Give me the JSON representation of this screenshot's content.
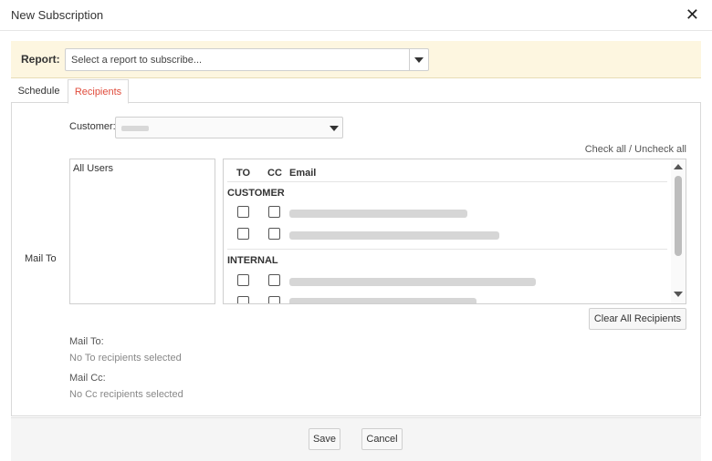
{
  "dialog": {
    "title": "New Subscription",
    "close_icon": "close-icon"
  },
  "report": {
    "label": "Report:",
    "value": "Select a report to subscribe..."
  },
  "tabs": [
    {
      "label": "Schedule"
    },
    {
      "label": "Recipients",
      "active": true
    }
  ],
  "recipients": {
    "mail_to_side_label": "Mail To",
    "customer_label": "Customer:",
    "check_all": "Check all",
    "separator": "/",
    "uncheck_all": "Uncheck all",
    "users_list": [
      "All Users"
    ],
    "columns": {
      "to": "TO",
      "cc": "CC",
      "email": "Email"
    },
    "groups": [
      {
        "name": "CUSTOMER"
      },
      {
        "name": "INTERNAL"
      }
    ],
    "clear_button": "Clear All Recipients",
    "mail_to_label": "Mail To:",
    "mail_to_value": "No To recipients selected",
    "mail_cc_label": "Mail Cc:",
    "mail_cc_value": "No Cc recipients selected"
  },
  "footer": {
    "save": "Save",
    "cancel": "Cancel"
  },
  "colors": {
    "accent": "#e04c3c",
    "report_bar_bg": "#fdf6e0"
  }
}
